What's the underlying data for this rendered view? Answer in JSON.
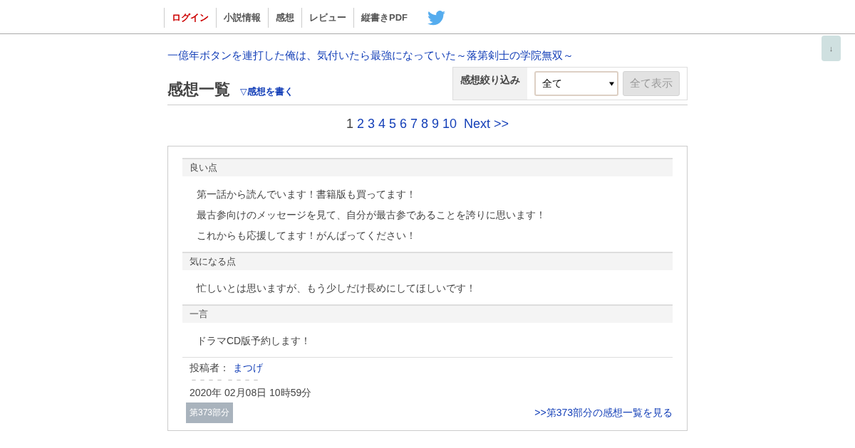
{
  "nav": [
    {
      "label": "ログイン",
      "kind": "login"
    },
    {
      "label": "小説情報",
      "kind": "link"
    },
    {
      "label": "感想",
      "kind": "link"
    },
    {
      "label": "レビュー",
      "kind": "link"
    },
    {
      "label": "縦書きPDF",
      "kind": "link"
    }
  ],
  "scroll_button": "↓",
  "novel_title": "一億年ボタンを連打した俺は、気付いたら最強になっていた～落第剣士の学院無双～",
  "heading": "感想一覧",
  "write_link": "▽感想を書く",
  "filter": {
    "label": "感想絞り込み",
    "value": "全て",
    "button": "全て表示"
  },
  "pagination": {
    "pages": [
      {
        "label": "1",
        "selected": true
      },
      {
        "label": "2",
        "selected": false
      },
      {
        "label": "3",
        "selected": false
      },
      {
        "label": "4",
        "selected": false
      },
      {
        "label": "5",
        "selected": false
      },
      {
        "label": "6",
        "selected": false
      },
      {
        "label": "7",
        "selected": false
      },
      {
        "label": "8",
        "selected": false
      },
      {
        "label": "9",
        "selected": false
      },
      {
        "label": "10",
        "selected": false
      }
    ],
    "next": "Next >>"
  },
  "review": {
    "sections": [
      {
        "title": "良い点",
        "lines": [
          "第一話から読んでいます！書籍版も買ってます！",
          "最古参向けのメッセージを見て、自分が最古参であることを誇りに思います！",
          "これからも応援してます！がんばってください！"
        ]
      },
      {
        "title": "気になる点",
        "lines": [
          "忙しいとは思いますが、もう少しだけ長めにしてほしいです！"
        ]
      },
      {
        "title": "一言",
        "lines": [
          "ドラマCD版予約します！"
        ]
      }
    ],
    "author_label": "投稿者：",
    "author": "まつげ",
    "dashes": "－－－－ －－－－",
    "date": "2020年 02月08日 10時59分",
    "part_tag": "第373部分",
    "part_link": ">>第373部分の感想一覧を見る"
  }
}
